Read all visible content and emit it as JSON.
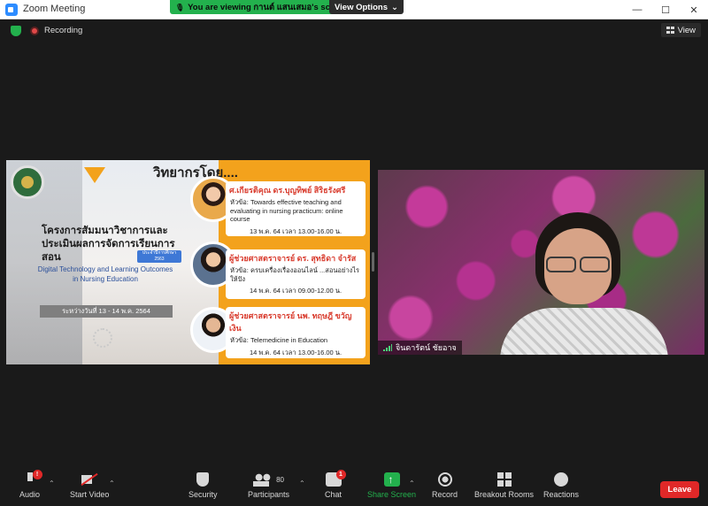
{
  "window": {
    "title": "Zoom Meeting",
    "banner_text": "You are viewing กานต์ แสนเสมอ's screen",
    "view_options_label": "View Options",
    "controls": {
      "minimize": "—",
      "maximize": "☐",
      "close": "✕"
    }
  },
  "meeting": {
    "recording_label": "Recording",
    "view_label": "View"
  },
  "slide": {
    "heading": "วิทยากรโดย....",
    "project_title": "โครงการสัมมนาวิชาการและประเมินผลการจัดการเรียนการสอน",
    "badge_text": "ประจำปีการศึกษา 2563",
    "english_title": "Digital Technology and Learning Outcomes in Nursing Education",
    "period_text": "ระหว่างวันที่ 13 - 14 พ.ค. 2564",
    "speakers": [
      {
        "name": "ศ.เกียรติคุณ ดร.บุญทิพย์ สิริธรังศรี",
        "topic": "หัวข้อ: Towards effective teaching and evaluating in nursing practicum: online course",
        "time": "13 พ.ค. 64 เวลา 13.00-16.00 น."
      },
      {
        "name": "ผู้ช่วยศาสตราจารย์ ดร. สุทธิดา จำรัส",
        "topic": "หัวข้อ: ครบเครื่องเรื่องออนไลน์ ...สอนอย่างไรให้ปัง",
        "time": "14 พ.ค. 64 เวลา 09.00-12.00 น."
      },
      {
        "name": "ผู้ช่วยศาสตราจารย์ นพ. ทฤษฎี ขวัญเงิน",
        "topic": "หัวข้อ: Telemedicine in Education",
        "time": "14 พ.ค. 64 เวลา 13.00-16.00 น."
      }
    ]
  },
  "participant": {
    "name": "จินดารัตน์ ชัยอาจ"
  },
  "toolbar": {
    "audio": {
      "label": "Audio",
      "badge": "!"
    },
    "start_video": {
      "label": "Start Video"
    },
    "security": {
      "label": "Security"
    },
    "participants": {
      "label": "Participants",
      "count": "80"
    },
    "chat": {
      "label": "Chat",
      "badge": "1"
    },
    "share_screen": {
      "label": "Share Screen"
    },
    "record": {
      "label": "Record"
    },
    "breakout_rooms": {
      "label": "Breakout Rooms"
    },
    "reactions": {
      "label": "Reactions"
    },
    "leave": {
      "label": "Leave"
    },
    "caret": "⌃"
  },
  "colors": {
    "accent_green": "#23b14d",
    "leave_red": "#e02828",
    "slide_orange": "#f3a21c",
    "speaker_name_red": "#d93d2f"
  }
}
